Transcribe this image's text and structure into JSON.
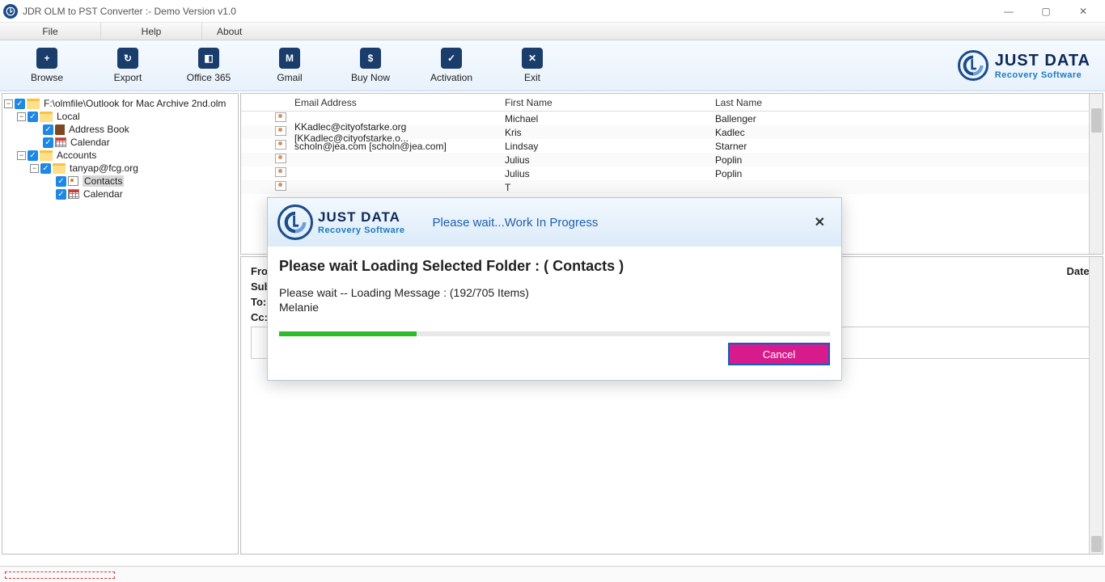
{
  "window": {
    "title": "JDR OLM to PST Converter :- Demo Version v1.0"
  },
  "menu": [
    "File",
    "Help",
    "About"
  ],
  "toolbar": [
    {
      "label": "Browse",
      "glyph": "+"
    },
    {
      "label": "Export",
      "glyph": "↻"
    },
    {
      "label": "Office 365",
      "glyph": "◧"
    },
    {
      "label": "Gmail",
      "glyph": "M"
    },
    {
      "label": "Buy Now",
      "glyph": "$"
    },
    {
      "label": "Activation",
      "glyph": "✓"
    },
    {
      "label": "Exit",
      "glyph": "✕"
    }
  ],
  "brand": {
    "line1": "JUST DATA",
    "line2": "Recovery Software"
  },
  "tree": {
    "root": "F:\\olmfile\\Outlook for Mac Archive 2nd.olm",
    "local": "Local",
    "addressbook": "Address Book",
    "calendar": "Calendar",
    "accounts": "Accounts",
    "email": "tanyap@fcg.org",
    "contacts": "Contacts",
    "calendar2": "Calendar"
  },
  "table": {
    "headers": {
      "email": "Email Address",
      "first": "First Name",
      "last": "Last Name"
    },
    "rows": [
      {
        "email": "",
        "first": "Michael",
        "last": "Ballenger"
      },
      {
        "email": "KKadlec@cityofstarke.org [KKadlec@cityofstarke.o...",
        "first": "Kris",
        "last": "Kadlec"
      },
      {
        "email": "scholn@jea.com [scholn@jea.com]",
        "first": "Lindsay",
        "last": "Starner"
      },
      {
        "email": "",
        "first": "Julius",
        "last": "Poplin"
      },
      {
        "email": "",
        "first": "Julius",
        "last": "Poplin"
      },
      {
        "email": "",
        "first": "T",
        "last": ""
      }
    ]
  },
  "msgpane": {
    "from": "From:",
    "subject": "Subject:",
    "to": "To:",
    "cc": "Cc:",
    "date": "Date:"
  },
  "modal": {
    "barTitle": "Please wait...Work In Progress",
    "close": "✕",
    "heading": "Please wait Loading Selected Folder : ( Contacts )",
    "line1": "Please wait -- Loading Message : (192/705 Items)",
    "line2": "Melanie",
    "cancel": "Cancel",
    "brand1": "JUST DATA",
    "brand2": "Recovery Software"
  }
}
